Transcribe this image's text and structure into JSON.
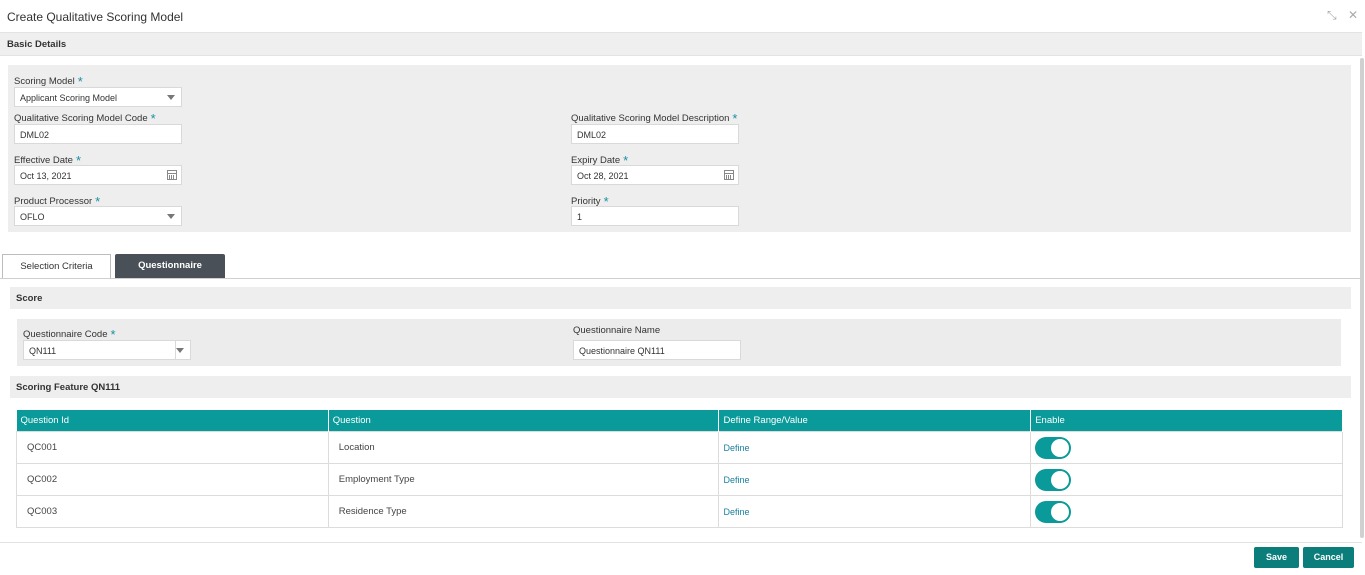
{
  "window": {
    "title": "Create Qualitative Scoring Model",
    "minimize_glyph": "⤡",
    "close_glyph": "✕"
  },
  "basic_details": {
    "heading": "Basic Details",
    "scoring_model": {
      "label": "Scoring Model",
      "value": "Applicant Scoring Model"
    },
    "code": {
      "label": "Qualitative Scoring Model Code",
      "value": "DML02"
    },
    "description": {
      "label": "Qualitative Scoring Model Description",
      "value": "DML02"
    },
    "effective_date": {
      "label": "Effective Date",
      "value": "Oct 13, 2021"
    },
    "expiry_date": {
      "label": "Expiry Date",
      "value": "Oct 28, 2021"
    },
    "product_processor": {
      "label": "Product Processor",
      "value": "OFLO"
    },
    "priority": {
      "label": "Priority",
      "value": "1"
    },
    "required_mark": "*"
  },
  "tabs": [
    {
      "label": "Selection Criteria",
      "active": false
    },
    {
      "label": "Questionnaire",
      "active": true
    }
  ],
  "score": {
    "heading": "Score",
    "questionnaire_code": {
      "label": "Questionnaire Code",
      "value": "QN111"
    },
    "questionnaire_name": {
      "label": "Questionnaire Name",
      "value": "Questionnaire QN111"
    }
  },
  "scoring_feature": {
    "heading": "Scoring Feature QN111",
    "columns": [
      "Question Id",
      "Question",
      "Define Range/Value",
      "Enable"
    ],
    "rows": [
      {
        "id": "QC001",
        "question": "Location",
        "define": "Define",
        "enabled": true
      },
      {
        "id": "QC002",
        "question": "Employment Type",
        "define": "Define",
        "enabled": true
      },
      {
        "id": "QC003",
        "question": "Residence Type",
        "define": "Define",
        "enabled": true
      }
    ]
  },
  "footer": {
    "save": "Save",
    "cancel": "Cancel"
  },
  "colors": {
    "accent": "#0a9a99",
    "button": "#0b7d7a",
    "active_tab": "#4a5058",
    "required": "#1a8fa3"
  }
}
